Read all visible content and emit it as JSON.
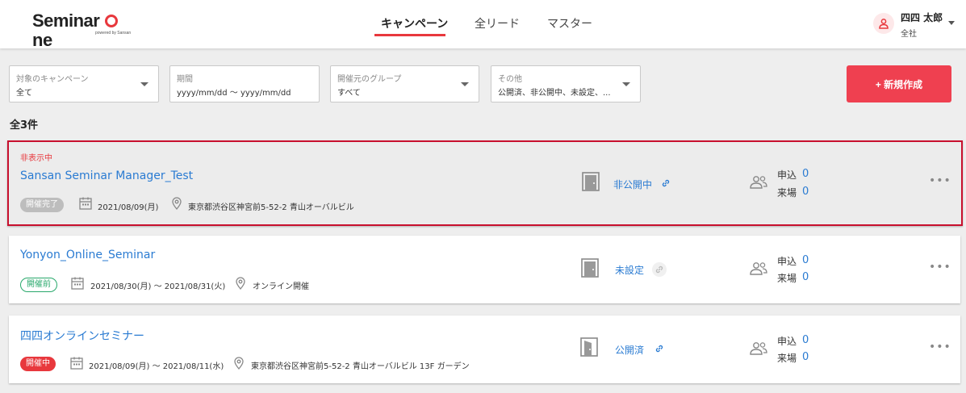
{
  "header": {
    "logo_text_1": "Seminar",
    "logo_text_2": "ne",
    "logo_sub": "powered by Sansan",
    "nav": [
      {
        "label": "キャンペーン",
        "active": true
      },
      {
        "label": "全リード",
        "active": false
      },
      {
        "label": "マスター",
        "active": false
      }
    ],
    "user": {
      "name": "四四 太郎",
      "org": "全社"
    }
  },
  "filters": [
    {
      "label": "対象のキャンペーン",
      "value": "全て"
    },
    {
      "label": "期間",
      "value": "yyyy/mm/dd 〜 yyyy/mm/dd"
    },
    {
      "label": "開催元のグループ",
      "value": "すべて"
    },
    {
      "label": "その他",
      "value": "公開済、非公開中、未設定、..."
    }
  ],
  "new_button": "+ 新規作成",
  "total": "全3件",
  "stat_labels": {
    "apply": "申込",
    "visit": "来場"
  },
  "campaigns": [
    {
      "hidden_tag": "非表示中",
      "title": "Sansan Seminar Manager_Test",
      "status": "開催完了",
      "date": "2021/08/09(月)",
      "location": "東京都渋谷区神宮前5-52-2 青山オーバルビル",
      "publish": "非公開中",
      "apply": "0",
      "visit": "0"
    },
    {
      "title": "Yonyon_Online_Seminar",
      "status": "開催前",
      "date": "2021/08/30(月) 〜 2021/08/31(火)",
      "location": "オンライン開催",
      "publish": "未設定",
      "apply": "0",
      "visit": "0"
    },
    {
      "title": "四四オンラインセミナー",
      "status": "開催中",
      "date": "2021/08/09(月) 〜 2021/08/11(水)",
      "location": "東京都渋谷区神宮前5-52-2 青山オーバルビル 13F ガーデン",
      "publish": "公開済",
      "apply": "0",
      "visit": "0"
    }
  ],
  "colors": {
    "accent": "#e8383d",
    "link": "#2a7bd2",
    "live": "#e8383d",
    "before": "#28a86b",
    "done": "#bdbdbd"
  }
}
